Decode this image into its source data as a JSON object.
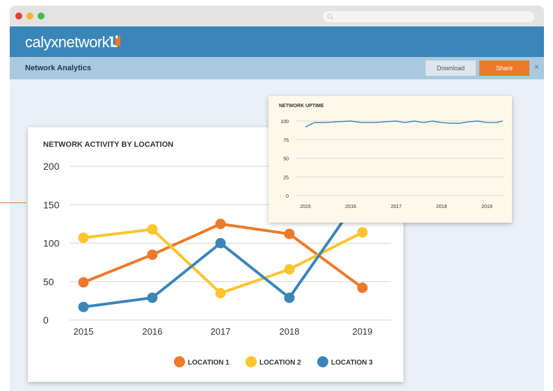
{
  "app": {
    "brand": "calyxnetwork",
    "page_title": "Network Analytics",
    "download_label": "Download",
    "share_label": "Share",
    "close_label": "×"
  },
  "colors": {
    "location1": "#ec7a2b",
    "location2": "#fcc42d",
    "location3": "#3b86b8",
    "appbar": "#3b86b8",
    "share": "#ec7a2b"
  },
  "chart_data": [
    {
      "type": "line",
      "title": "NETWORK ACTIVITY BY LOCATION",
      "categories": [
        "2015",
        "2016",
        "2017",
        "2018",
        "2019"
      ],
      "ylim": [
        0,
        200
      ],
      "yticks": [
        0,
        50,
        100,
        150,
        200
      ],
      "legend": "bottom-right",
      "grid": true,
      "series": [
        {
          "name": "LOCATION 1",
          "color": "#ec7a2b",
          "values": [
            49,
            85,
            125,
            112,
            42
          ]
        },
        {
          "name": "LOCATION 2",
          "color": "#fcc42d",
          "values": [
            107,
            118,
            35,
            66,
            114
          ]
        },
        {
          "name": "LOCATION 3",
          "color": "#3b86b8",
          "values": [
            17,
            29,
            100,
            29,
            165
          ]
        }
      ]
    },
    {
      "type": "line",
      "title": "NETWORK UPTIME",
      "categories": [
        "2015",
        "2016",
        "2017",
        "2018",
        "2019"
      ],
      "ylim": [
        0,
        100
      ],
      "yticks": [
        0,
        25,
        50,
        75,
        100
      ],
      "grid": true,
      "series": [
        {
          "color": "#3b86b8",
          "x": [
            2015,
            2015.2,
            2015.4,
            2015.7,
            2016,
            2016.25,
            2016.5,
            2016.75,
            2017,
            2017.2,
            2017.4,
            2017.6,
            2017.8,
            2018,
            2018.2,
            2018.4,
            2018.6,
            2018.8,
            2019,
            2019.2,
            2019.35
          ],
          "values": [
            92,
            98,
            98,
            99,
            100,
            98,
            98,
            99,
            100,
            98,
            100,
            98,
            100,
            98,
            97,
            97,
            99,
            100,
            98,
            98,
            100
          ]
        }
      ]
    }
  ]
}
